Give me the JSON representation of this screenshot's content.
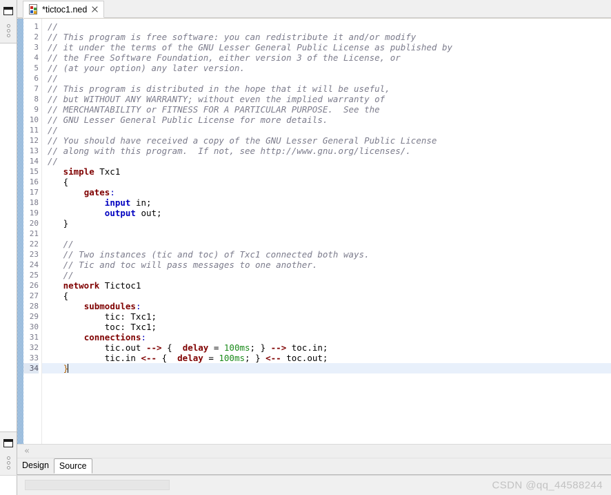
{
  "window": {
    "title": "*tictoc1.ned"
  },
  "left_trim": {
    "top_stack": {
      "restore_icon": "restore-view-icon",
      "handle_icon": "view-stack-handle-icon"
    },
    "bottom_stack": {
      "restore_icon": "restore-view-icon",
      "handle_icon": "view-stack-handle-icon"
    }
  },
  "editor_tab": {
    "icon": "ned-file-icon",
    "label": "*tictoc1.ned",
    "close_icon": "close-icon",
    "dirty": true
  },
  "page_tabs": {
    "items": [
      {
        "label": "Design",
        "active": false
      },
      {
        "label": "Source",
        "active": true
      }
    ]
  },
  "scrollbar": {
    "left_chevron": "«"
  },
  "watermark": {
    "text": "CSDN @qq_44588244"
  },
  "colors": {
    "keyword": "#7f0000",
    "type_keyword": "#0000c0",
    "comment": "#7c7c8c",
    "number": "#1a8a1a",
    "current_line": "#e8f0fb",
    "change_bar": "#3d7ebd",
    "gutter_text": "#7a7a8a",
    "watermark": "#c2c2c2"
  },
  "editor": {
    "first_line": 1,
    "last_line": 34,
    "current_line": 34,
    "cursor_line": 34,
    "cursor_column": 6,
    "line_numbers": [
      1,
      2,
      3,
      4,
      5,
      6,
      7,
      8,
      9,
      10,
      11,
      12,
      13,
      14,
      15,
      16,
      17,
      18,
      19,
      20,
      21,
      22,
      23,
      24,
      25,
      26,
      27,
      28,
      29,
      30,
      31,
      32,
      33,
      34
    ],
    "lines": [
      {
        "n": 1,
        "tokens": [
          {
            "t": "cmt",
            "s": "//"
          }
        ]
      },
      {
        "n": 2,
        "tokens": [
          {
            "t": "cmt",
            "s": "// This program is free software: you can redistribute it and/or modify"
          }
        ]
      },
      {
        "n": 3,
        "tokens": [
          {
            "t": "cmt",
            "s": "// it under the terms of the GNU Lesser General Public License as published by"
          }
        ]
      },
      {
        "n": 4,
        "tokens": [
          {
            "t": "cmt",
            "s": "// the Free Software Foundation, either version 3 of the License, or"
          }
        ]
      },
      {
        "n": 5,
        "tokens": [
          {
            "t": "cmt",
            "s": "// (at your option) any later version."
          }
        ]
      },
      {
        "n": 6,
        "tokens": [
          {
            "t": "cmt",
            "s": "//"
          }
        ]
      },
      {
        "n": 7,
        "tokens": [
          {
            "t": "cmt",
            "s": "// This program is distributed in the hope that it will be useful,"
          }
        ]
      },
      {
        "n": 8,
        "tokens": [
          {
            "t": "cmt",
            "s": "// but WITHOUT ANY WARRANTY; without even the implied warranty of"
          }
        ]
      },
      {
        "n": 9,
        "tokens": [
          {
            "t": "cmt",
            "s": "// MERCHANTABILITY or FITNESS FOR A PARTICULAR PURPOSE.  See the"
          }
        ]
      },
      {
        "n": 10,
        "tokens": [
          {
            "t": "cmt",
            "s": "// GNU Lesser General Public License for more details."
          }
        ]
      },
      {
        "n": 11,
        "tokens": [
          {
            "t": "cmt",
            "s": "//"
          }
        ]
      },
      {
        "n": 12,
        "tokens": [
          {
            "t": "cmt",
            "s": "// You should have received a copy of the GNU Lesser General Public License"
          }
        ]
      },
      {
        "n": 13,
        "tokens": [
          {
            "t": "cmt",
            "s": "// along with this program.  If not, see http://www.gnu.org/licenses/."
          }
        ]
      },
      {
        "n": 14,
        "tokens": [
          {
            "t": "cmt",
            "s": "//"
          }
        ]
      },
      {
        "n": 15,
        "tokens": [
          {
            "t": "txt",
            "s": "   "
          },
          {
            "t": "kw",
            "s": "simple"
          },
          {
            "t": "txt",
            "s": " Txc1"
          }
        ]
      },
      {
        "n": 16,
        "tokens": [
          {
            "t": "txt",
            "s": "   "
          },
          {
            "t": "brace",
            "s": "{"
          }
        ]
      },
      {
        "n": 17,
        "tokens": [
          {
            "t": "txt",
            "s": "       "
          },
          {
            "t": "kw",
            "s": "gates"
          },
          {
            "t": "pun",
            "s": ":"
          }
        ]
      },
      {
        "n": 18,
        "tokens": [
          {
            "t": "txt",
            "s": "           "
          },
          {
            "t": "kw2",
            "s": "input"
          },
          {
            "t": "txt",
            "s": " in;"
          }
        ]
      },
      {
        "n": 19,
        "tokens": [
          {
            "t": "txt",
            "s": "           "
          },
          {
            "t": "kw2",
            "s": "output"
          },
          {
            "t": "txt",
            "s": " out;"
          }
        ]
      },
      {
        "n": 20,
        "tokens": [
          {
            "t": "txt",
            "s": "   "
          },
          {
            "t": "brace",
            "s": "}"
          }
        ]
      },
      {
        "n": 21,
        "tokens": [
          {
            "t": "txt",
            "s": ""
          }
        ]
      },
      {
        "n": 22,
        "tokens": [
          {
            "t": "txt",
            "s": "   "
          },
          {
            "t": "cmt",
            "s": "//"
          }
        ]
      },
      {
        "n": 23,
        "tokens": [
          {
            "t": "txt",
            "s": "   "
          },
          {
            "t": "cmt",
            "s": "// Two instances (tic and toc) of Txc1 connected both ways."
          }
        ]
      },
      {
        "n": 24,
        "tokens": [
          {
            "t": "txt",
            "s": "   "
          },
          {
            "t": "cmt",
            "s": "// Tic and toc will pass messages to one another."
          }
        ]
      },
      {
        "n": 25,
        "tokens": [
          {
            "t": "txt",
            "s": "   "
          },
          {
            "t": "cmt",
            "s": "//"
          }
        ]
      },
      {
        "n": 26,
        "tokens": [
          {
            "t": "txt",
            "s": "   "
          },
          {
            "t": "kw",
            "s": "network"
          },
          {
            "t": "txt",
            "s": " Tictoc1"
          }
        ]
      },
      {
        "n": 27,
        "tokens": [
          {
            "t": "txt",
            "s": "   "
          },
          {
            "t": "brace",
            "s": "{"
          }
        ]
      },
      {
        "n": 28,
        "tokens": [
          {
            "t": "txt",
            "s": "       "
          },
          {
            "t": "kw",
            "s": "submodules"
          },
          {
            "t": "pun",
            "s": ":"
          }
        ]
      },
      {
        "n": 29,
        "tokens": [
          {
            "t": "txt",
            "s": "           tic: Txc1;"
          }
        ]
      },
      {
        "n": 30,
        "tokens": [
          {
            "t": "txt",
            "s": "           toc: Txc1;"
          }
        ]
      },
      {
        "n": 31,
        "tokens": [
          {
            "t": "txt",
            "s": "       "
          },
          {
            "t": "kw",
            "s": "connections"
          },
          {
            "t": "pun",
            "s": ":"
          }
        ]
      },
      {
        "n": 32,
        "tokens": [
          {
            "t": "txt",
            "s": "           tic.out "
          },
          {
            "t": "op",
            "s": "-->"
          },
          {
            "t": "txt",
            "s": " {  "
          },
          {
            "t": "kw",
            "s": "delay"
          },
          {
            "t": "txt",
            "s": " = "
          },
          {
            "t": "num",
            "s": "100ms"
          },
          {
            "t": "txt",
            "s": "; } "
          },
          {
            "t": "op",
            "s": "-->"
          },
          {
            "t": "txt",
            "s": " toc.in;"
          }
        ]
      },
      {
        "n": 33,
        "tokens": [
          {
            "t": "txt",
            "s": "           tic.in "
          },
          {
            "t": "op",
            "s": "<--"
          },
          {
            "t": "txt",
            "s": " {  "
          },
          {
            "t": "kw",
            "s": "delay"
          },
          {
            "t": "txt",
            "s": " = "
          },
          {
            "t": "num",
            "s": "100ms"
          },
          {
            "t": "txt",
            "s": "; } "
          },
          {
            "t": "op",
            "s": "<--"
          },
          {
            "t": "txt",
            "s": " toc.out;"
          }
        ]
      },
      {
        "n": 34,
        "tokens": [
          {
            "t": "txt",
            "s": "   "
          },
          {
            "t": "brace-hl",
            "s": "}"
          },
          {
            "t": "caret",
            "s": ""
          }
        ]
      }
    ]
  }
}
